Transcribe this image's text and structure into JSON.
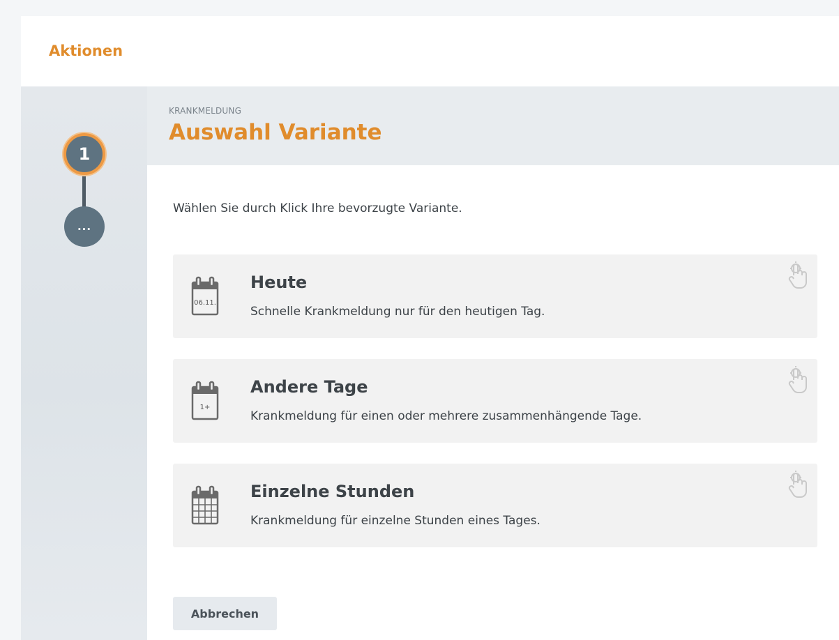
{
  "panel": {
    "title": "Aktionen"
  },
  "stepper": {
    "steps": [
      {
        "label": "1",
        "state": "active"
      },
      {
        "label": "...",
        "state": "pending"
      }
    ],
    "colors": {
      "active_ring": "#ee9a44",
      "circle": "#5e7381"
    }
  },
  "header": {
    "subtitle": "KRANKMELDUNG",
    "title": "Auswahl Variante"
  },
  "instruction": "Wählen Sie durch Klick Ihre bevorzugte Variante.",
  "options": [
    {
      "title": "Heute",
      "description": "Schnelle Krankmeldung nur für den heutigen Tag.",
      "icon": "calendar-date-icon",
      "icon_text": "06.11."
    },
    {
      "title": "Andere Tage",
      "description": "Krankmeldung für einen oder mehrere zusammenhängende Tage.",
      "icon": "calendar-multiple-days-icon",
      "icon_text": "1+"
    },
    {
      "title": "Einzelne Stunden",
      "description": "Krankmeldung für einzelne Stunden eines Tages.",
      "icon": "calendar-grid-icon"
    }
  ],
  "cancel_label": "Abbrechen",
  "accent_color": "#e08c2c"
}
